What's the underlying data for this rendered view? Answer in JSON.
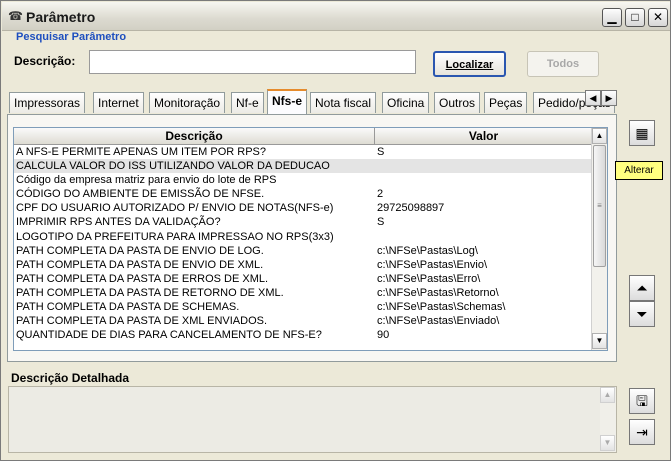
{
  "window": {
    "title": "Parâmetro",
    "controls": {
      "minimize": "▁",
      "maximize": "□",
      "close": "✕"
    }
  },
  "search": {
    "section_label": "Pesquisar Parâmetro",
    "description_label": "Descrição:",
    "description_value": "",
    "localizar_label": "Localizar",
    "todos_label": "Todos"
  },
  "tabs": [
    {
      "label": "Impressoras",
      "active": false
    },
    {
      "label": "Internet",
      "active": false
    },
    {
      "label": "Monitoração",
      "active": false
    },
    {
      "label": "Nf-e",
      "active": false
    },
    {
      "label": "Nfs-e",
      "active": true
    },
    {
      "label": "Nota fiscal",
      "active": false
    },
    {
      "label": "Oficina",
      "active": false
    },
    {
      "label": "Outros",
      "active": false
    },
    {
      "label": "Peças",
      "active": false
    },
    {
      "label": "Pedido/peças",
      "active": false
    }
  ],
  "grid": {
    "columns": [
      "Descrição",
      "Valor"
    ],
    "rows": [
      {
        "descricao": "A NFS-E PERMITE APENAS UM ITEM POR RPS?",
        "valor": "S"
      },
      {
        "descricao": "CALCULA VALOR DO ISS UTILIZANDO VALOR DA DEDUCAO",
        "valor": ""
      },
      {
        "descricao": "Código da empresa matriz para envio do lote de RPS",
        "valor": ""
      },
      {
        "descricao": "CÓDIGO DO AMBIENTE DE EMISSÃO DE NFSE.",
        "valor": "2"
      },
      {
        "descricao": "CPF DO USUARIO AUTORIZADO P/ ENVIO DE NOTAS(NFS-e)",
        "valor": "29725098897"
      },
      {
        "descricao": "IMPRIMIR RPS ANTES DA VALIDAÇÃO?",
        "valor": "S"
      },
      {
        "descricao": "LOGOTIPO DA PREFEITURA PARA IMPRESSAO NO RPS(3x3)",
        "valor": ""
      },
      {
        "descricao": "PATH COMPLETA DA PASTA DE ENVIO DE LOG.",
        "valor": "c:\\NFSe\\Pastas\\Log\\"
      },
      {
        "descricao": "PATH COMPLETA DA PASTA DE ENVIO DE XML.",
        "valor": "c:\\NFSe\\Pastas\\Envio\\"
      },
      {
        "descricao": "PATH COMPLETA DA PASTA DE ERROS DE XML.",
        "valor": "c:\\NFSe\\Pastas\\Erro\\"
      },
      {
        "descricao": "PATH COMPLETA DA PASTA DE RETORNO DE XML.",
        "valor": "c:\\NFSe\\Pastas\\Retorno\\"
      },
      {
        "descricao": "PATH COMPLETA DA PASTA DE SCHEMAS.",
        "valor": "c:\\NFSe\\Pastas\\Schemas\\"
      },
      {
        "descricao": "PATH COMPLETA DA PASTA DE XML ENVIADOS.",
        "valor": "c:\\NFSe\\Pastas\\Enviado\\"
      },
      {
        "descricao": "QUANTIDADE DE DIAS PARA CANCELAMENTO DE NFS-E?",
        "valor": "90"
      }
    ],
    "selected_row": 1
  },
  "side": {
    "tooltip": "Alterar",
    "icons": [
      "edit-grid-icon",
      "move-up-icon",
      "move-down-icon",
      "save-icon",
      "exit-icon"
    ]
  },
  "detail": {
    "label": "Descrição Detalhada",
    "value": ""
  },
  "colors": {
    "link_blue": "#1e4fbf",
    "active_tab_accent": "#e68b2c",
    "tooltip_bg": "#ffff80",
    "selected_row": "#e4e4e4"
  }
}
